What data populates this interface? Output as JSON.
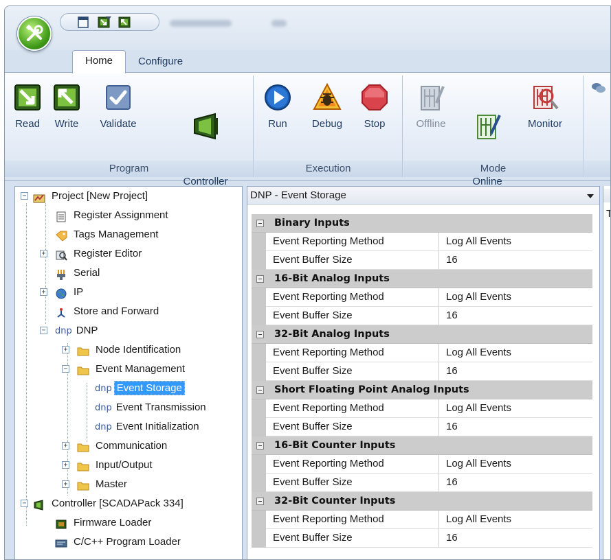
{
  "window": {
    "quick_access": [
      "read-icon",
      "write-icon",
      "new-icon"
    ],
    "title_blurred": true
  },
  "tabs": [
    {
      "label": "Home",
      "active": true
    },
    {
      "label": "Configure",
      "active": false
    }
  ],
  "ribbon": {
    "groups": [
      {
        "label": "Program",
        "buttons": [
          {
            "label": "Read",
            "icon": "read-icon"
          },
          {
            "label": "Write",
            "icon": "write-icon"
          },
          {
            "label": "Validate",
            "icon": "validate-icon"
          },
          {
            "label": "Change\nController",
            "icon": "change-controller-icon"
          }
        ]
      },
      {
        "label": "Execution",
        "buttons": [
          {
            "label": "Run",
            "icon": "run-icon"
          },
          {
            "label": "Debug",
            "icon": "debug-icon"
          },
          {
            "label": "Stop",
            "icon": "stop-icon"
          }
        ]
      },
      {
        "label": "Mode",
        "buttons": [
          {
            "label": "Offline",
            "icon": "offline-icon",
            "disabled": true
          },
          {
            "label": "Edit\nOnline",
            "icon": "edit-online-icon"
          },
          {
            "label": "Monitor",
            "icon": "monitor-icon"
          }
        ]
      }
    ]
  },
  "tree": {
    "items": [
      {
        "label": "Project [New Project]",
        "icon": "project-icon"
      },
      {
        "label": "Register Assignment",
        "icon": "register-assignment-icon"
      },
      {
        "label": "Tags Management",
        "icon": "tags-icon"
      },
      {
        "label": "Register Editor",
        "icon": "register-editor-icon"
      },
      {
        "label": "Serial",
        "icon": "serial-icon"
      },
      {
        "label": "IP",
        "icon": "ip-globe-icon"
      },
      {
        "label": "Store and Forward",
        "icon": "store-forward-icon"
      },
      {
        "label": "DNP",
        "prefix": "dnp"
      },
      {
        "label": "Node Identification",
        "icon": "folder-icon"
      },
      {
        "label": "Event Management",
        "icon": "folder-icon"
      },
      {
        "label": "Event Storage",
        "prefix": "dnp",
        "selected": true
      },
      {
        "label": "Event Transmission",
        "prefix": "dnp"
      },
      {
        "label": "Event Initialization",
        "prefix": "dnp"
      },
      {
        "label": "Communication",
        "icon": "folder-icon"
      },
      {
        "label": "Input/Output",
        "icon": "folder-icon"
      },
      {
        "label": "Master",
        "icon": "folder-icon"
      },
      {
        "label": "Controller [SCADAPack 334]",
        "icon": "controller-icon"
      },
      {
        "label": "Firmware Loader",
        "icon": "firmware-icon"
      },
      {
        "label": "C/C++ Program Loader",
        "icon": "program-loader-icon"
      }
    ]
  },
  "property_grid": {
    "title": "DNP - Event Storage",
    "categories": [
      {
        "name": "Binary Inputs",
        "rows": [
          {
            "name": "Event Reporting Method",
            "value": "Log All Events"
          },
          {
            "name": "Event Buffer Size",
            "value": "16"
          }
        ]
      },
      {
        "name": "16-Bit Analog Inputs",
        "rows": [
          {
            "name": "Event Reporting Method",
            "value": "Log All Events"
          },
          {
            "name": "Event Buffer Size",
            "value": "16"
          }
        ]
      },
      {
        "name": "32-Bit Analog Inputs",
        "rows": [
          {
            "name": "Event Reporting Method",
            "value": "Log All Events"
          },
          {
            "name": "Event Buffer Size",
            "value": "16"
          }
        ]
      },
      {
        "name": "Short Floating Point Analog Inputs",
        "rows": [
          {
            "name": "Event Reporting Method",
            "value": "Log All Events"
          },
          {
            "name": "Event Buffer Size",
            "value": "16"
          }
        ]
      },
      {
        "name": "16-Bit Counter Inputs",
        "rows": [
          {
            "name": "Event Reporting Method",
            "value": "Log All Events"
          },
          {
            "name": "Event Buffer Size",
            "value": "16"
          }
        ]
      },
      {
        "name": "32-Bit Counter Inputs",
        "rows": [
          {
            "name": "Event Reporting Method",
            "value": "Log All Events"
          },
          {
            "name": "Event Buffer Size",
            "value": "16"
          }
        ]
      }
    ]
  },
  "right_panel": {
    "letter": "T"
  }
}
